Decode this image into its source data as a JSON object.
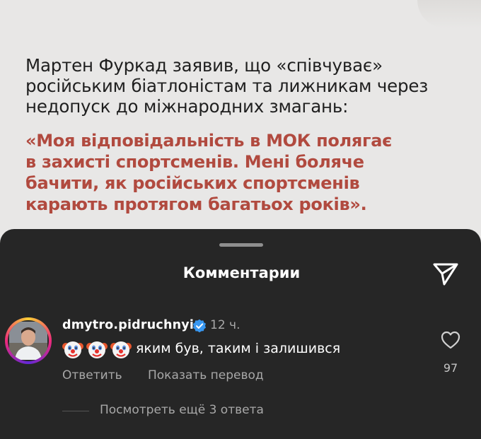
{
  "post": {
    "statement": "Мартен Фуркад заявив, що «співчуває»\nросійським біатлоністам та лижникам через\nнедопуск до міжнародних змагань:",
    "quote": "«Моя відповідальність в МОК полягає\nв захисті спортсменів. Мені боляче\nбачити, як російських спортсменів\nкарають протягом багатьох років».",
    "quote_color": "#b14a3f"
  },
  "sheet": {
    "title": "Комментарии",
    "send_icon": "paper-plane-icon"
  },
  "comment": {
    "username": "dmytro.pidruchnyi",
    "verified": true,
    "time": "12 ч.",
    "emojis": [
      "clown-face",
      "clown-face",
      "clown-face"
    ],
    "text": "яким був, таким і залишився",
    "reply_label": "Ответить",
    "translate_label": "Показать перевод",
    "likes": "97",
    "view_replies": "Посмотреть ещё 3 ответа"
  },
  "colors": {
    "sheet_bg": "#262626",
    "verified_blue": "#3897f0",
    "muted_text": "#a8a8a8"
  }
}
